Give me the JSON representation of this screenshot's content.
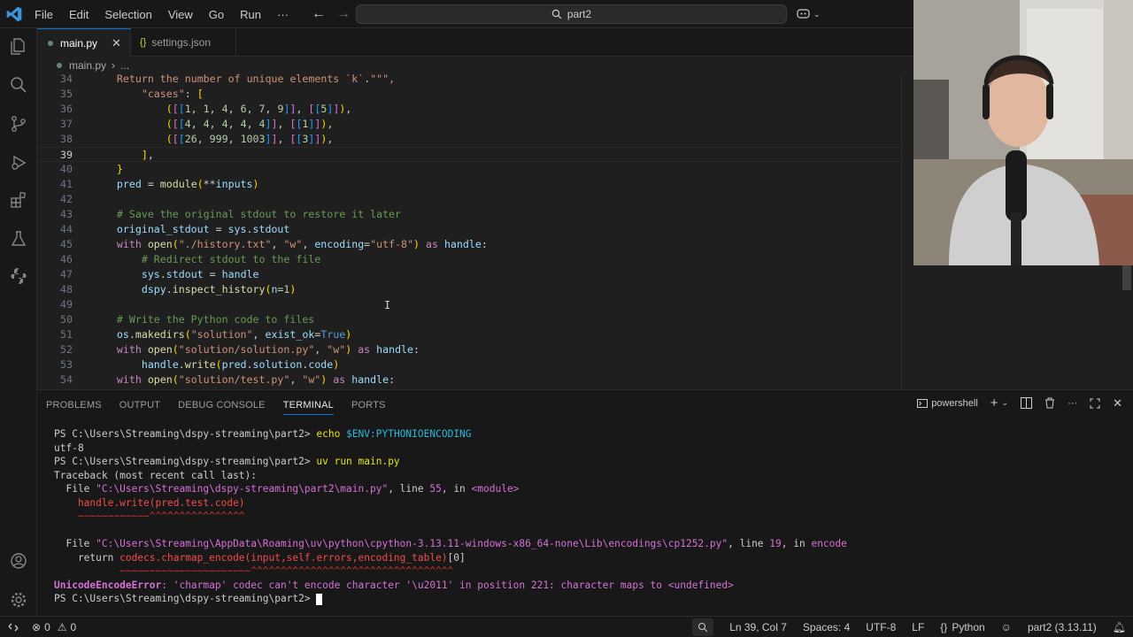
{
  "menu": [
    "File",
    "Edit",
    "Selection",
    "View",
    "Go",
    "Run",
    "···"
  ],
  "search": {
    "label": "part2"
  },
  "tabs": [
    {
      "label": "main.py",
      "active": true
    },
    {
      "label": "settings.json",
      "active": false
    }
  ],
  "breadcrumb": {
    "file": "main.py",
    "more": "..."
  },
  "editor": {
    "current_line": 39,
    "lines": [
      {
        "n": "34",
        "code": "    Return the number of unique elements `k`.\"\"\","
      },
      {
        "n": "35",
        "code": "        \"cases\": ["
      },
      {
        "n": "36",
        "code": "            ([[1, 1, 4, 6, 7, 9]], [[5]]),"
      },
      {
        "n": "37",
        "code": "            ([[4, 4, 4, 4, 4]], [[1]]),"
      },
      {
        "n": "38",
        "code": "            ([[26, 999, 1003]], [[3]]),"
      },
      {
        "n": "39",
        "code": "        ],"
      },
      {
        "n": "40",
        "code": "    }"
      },
      {
        "n": "41",
        "code": "    pred = module(**inputs)"
      },
      {
        "n": "42",
        "code": ""
      },
      {
        "n": "43",
        "code": "    # Save the original stdout to restore it later"
      },
      {
        "n": "44",
        "code": "    original_stdout = sys.stdout"
      },
      {
        "n": "45",
        "code": "    with open(\"./history.txt\", \"w\", encoding=\"utf-8\") as handle:"
      },
      {
        "n": "46",
        "code": "        # Redirect stdout to the file"
      },
      {
        "n": "47",
        "code": "        sys.stdout = handle"
      },
      {
        "n": "48",
        "code": "        dspy.inspect_history(n=1)"
      },
      {
        "n": "49",
        "code": ""
      },
      {
        "n": "50",
        "code": "    # Write the Python code to files"
      },
      {
        "n": "51",
        "code": "    os.makedirs(\"solution\", exist_ok=True)"
      },
      {
        "n": "52",
        "code": "    with open(\"solution/solution.py\", \"w\") as handle:"
      },
      {
        "n": "53",
        "code": "        handle.write(pred.solution.code)"
      },
      {
        "n": "54",
        "code": "    with open(\"solution/test.py\", \"w\") as handle:"
      }
    ]
  },
  "panel": {
    "tabs": [
      "PROBLEMS",
      "OUTPUT",
      "DEBUG CONSOLE",
      "TERMINAL",
      "PORTS"
    ],
    "active_tab": "TERMINAL",
    "shell": "powershell"
  },
  "terminal": {
    "prompt": "PS C:\\Users\\Streaming\\dspy-streaming\\part2>",
    "cmd1": "echo",
    "cmd1_arg": "$ENV:PYTHONIOENCODING",
    "out1": "utf-8",
    "cmd2": "uv run main.py",
    "traceback": "Traceback (most recent call last):",
    "file1_prefix": "  File ",
    "file1_path": "\"C:\\Users\\Streaming\\dspy-streaming\\part2\\main.py\"",
    "file1_line": ", line ",
    "file1_lineno": "55",
    "file1_in": ", in ",
    "file1_mod": "<module>",
    "code1": "    handle.write(pred.test.code)",
    "tilde1": "    ~~~~~~~~~~~~^^^^^^^^^^^^^^^^",
    "file2_prefix": "  File ",
    "file2_path": "\"C:\\Users\\Streaming\\AppData\\Roaming\\uv\\python\\cpython-3.13.11-windows-x86_64-none\\Lib\\encodings\\cp1252.py\"",
    "file2_line": ", line ",
    "file2_lineno": "19",
    "file2_in": ", in ",
    "file2_fn": "encode",
    "code2_prefix": "    return ",
    "code2": "codecs.charmap_encode(input,self.errors,encoding_table)",
    "code2_suffix": "[0]",
    "tilde2": "           ~~~~~~~~~~~~~~~~~~~~~~^^^^^^^^^^^^^^^^^^^^^^^^^^^^^^^^^^",
    "err_name": "UnicodeEncodeError",
    "err_msg": ": 'charmap' codec can't encode character '\\u2011' in position 221: character maps to <undefined>"
  },
  "status": {
    "errors": "0",
    "warnings": "0",
    "position": "Ln 39, Col 7",
    "spaces": "Spaces: 4",
    "encoding": "UTF-8",
    "eol": "LF",
    "language": "Python",
    "interpreter": "part2 (3.13.11)"
  },
  "colors": {
    "accent": "#0078d4",
    "background": "#1f1f1f",
    "sidebar": "#181818"
  }
}
